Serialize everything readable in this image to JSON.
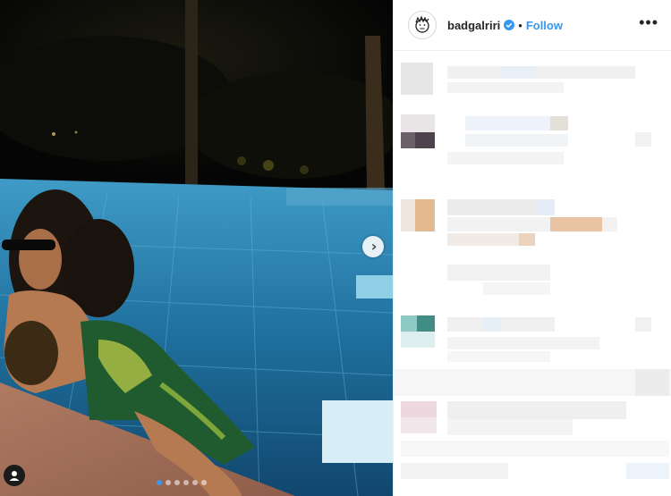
{
  "post": {
    "username": "badgalriri",
    "separator": "•",
    "follow_label": "Follow",
    "more_label": "•••",
    "verified": true
  },
  "carousel": {
    "slide_count": 6,
    "current_slide": 1
  },
  "icons": {
    "next": "chevron-right-icon",
    "tag": "user-tag-icon",
    "verified": "verified-badge-icon",
    "more": "more-options-icon"
  },
  "colors": {
    "follow": "#3897f0",
    "username": "#262626",
    "active_dot": "#3b97f0",
    "verified": "#3897f0"
  }
}
